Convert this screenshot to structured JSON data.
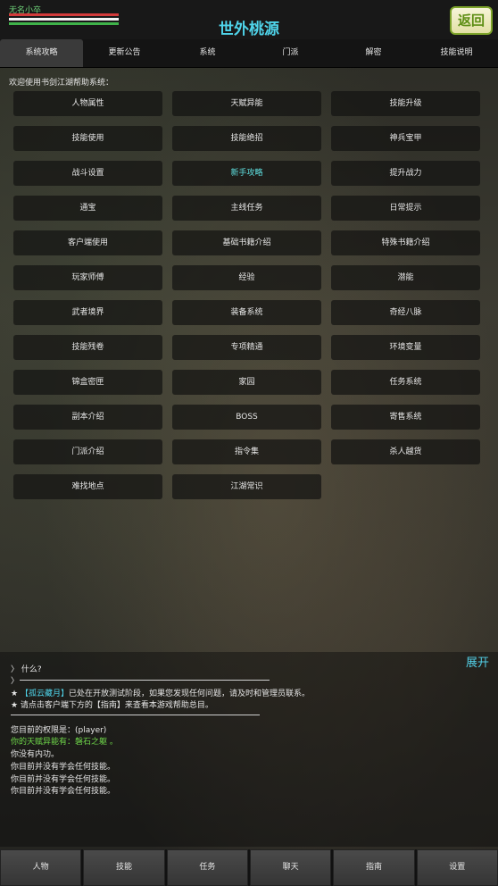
{
  "header": {
    "player_name": "无名小卒",
    "title": "世外桃源",
    "back_label": "返回"
  },
  "tabs": [
    {
      "label": "系统攻略",
      "active": true
    },
    {
      "label": "更新公告"
    },
    {
      "label": "系统"
    },
    {
      "label": "门派"
    },
    {
      "label": "解密"
    },
    {
      "label": "技能说明"
    }
  ],
  "welcome": "欢迎使用书剑江湖帮助系统：",
  "help_buttons": [
    "人物属性",
    "天赋异能",
    "技能升级",
    "技能使用",
    "技能绝招",
    "神兵宝甲",
    "战斗设置",
    "新手攻略",
    "提升战力",
    "通宝",
    "主线任务",
    "日常提示",
    "客户端使用",
    "基础书籍介绍",
    "特殊书籍介绍",
    "玩家师傅",
    "经验",
    "潜能",
    "武者境界",
    "装备系统",
    "奇经八脉",
    "技能残卷",
    "专项精通",
    "环境变量",
    "锦盒密匣",
    "家园",
    "任务系统",
    "副本介绍",
    "BOSS",
    "寄售系统",
    "门派介绍",
    "指令集",
    "杀人越货",
    "难找地点",
    "江湖常识"
  ],
  "highlight_button": "新手攻略",
  "console": {
    "expand_label": "展开",
    "line1": "〉 什么?",
    "line2": "〉",
    "line3_star": "★",
    "line3_link": "【孤云藏月】",
    "line3_rest": "已处在开放测试阶段，如果您发现任何问题，请及时和管理员联系。",
    "line4": "★ 请点击客户端下方的【指南】来查看本游戏帮助总目。",
    "line5": "您目前的权限是：(player)",
    "line6": "你的天赋异能有：磐石之躯 。",
    "line7": "你没有内功。",
    "line8": "你目前并没有学会任何技能。",
    "line9": "你目前并没有学会任何技能。",
    "line10": "你目前并没有学会任何技能。"
  },
  "bottom_nav": [
    "人物",
    "技能",
    "任务",
    "聊天",
    "指南",
    "设置"
  ],
  "colors": {
    "accent_cyan": "#4fd4ea",
    "green_text": "#6fd84a"
  }
}
